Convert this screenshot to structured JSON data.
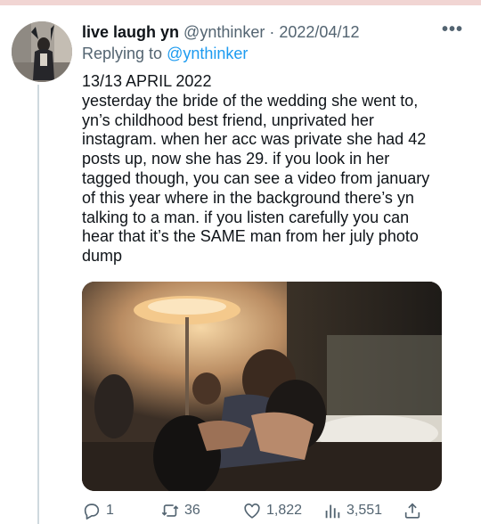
{
  "tweet": {
    "display_name": "live laugh yn",
    "handle": "@ynthinker",
    "separator": "·",
    "date": "2022/04/12",
    "reply_prefix": "Replying to",
    "reply_to": "@ynthinker",
    "text_lines": [
      "13/13 APRIL 2022",
      "yesterday the bride of the wedding she went to,",
      "yn’s childhood best friend, unprivated her",
      "instagram. when her acc was private she had 42",
      "posts up, now she has 29. if you look in her",
      "tagged though, you can see a video from january",
      "of this year where in the background there’s yn",
      "talking to a man. if you listen carefully you can",
      "hear that it’s the SAME man from her july photo",
      "dump"
    ]
  },
  "actions": {
    "replies": "1",
    "retweets": "36",
    "likes": "1,822",
    "views": "3,551"
  },
  "icons": {
    "more": "more-horizontal-icon",
    "reply": "reply-bubble-icon",
    "retweet": "retweet-icon",
    "like": "heart-icon",
    "views": "bar-chart-icon",
    "share": "share-upload-icon"
  },
  "colors": {
    "accent": "#1d9bf0",
    "secondary_text": "#536471",
    "primary_text": "#0f1419",
    "thread_line": "#cfd9de"
  }
}
